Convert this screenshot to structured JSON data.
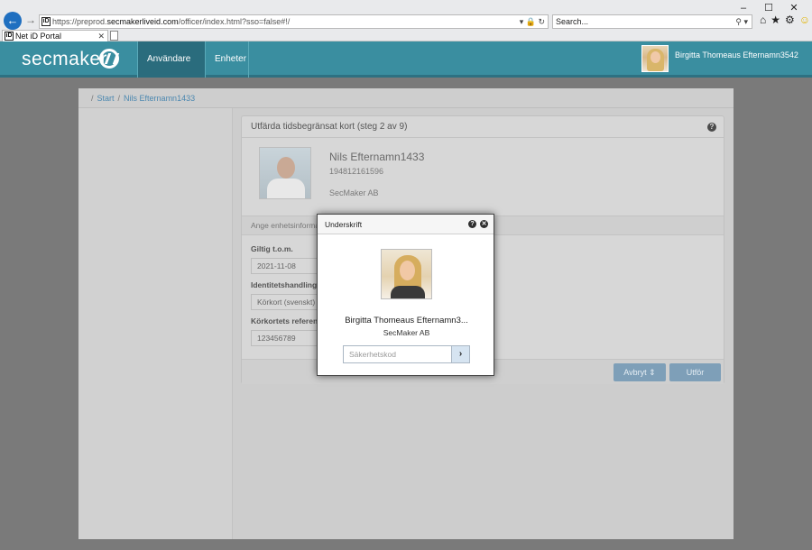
{
  "browser": {
    "url_prefix": "https://preprod.",
    "url_host": "secmakerliveid.com",
    "url_path": "/officer/index.html?sso=false#!/",
    "search_text": "Search...",
    "tab_title": "Net iD Portal",
    "favicon_text": "iD"
  },
  "header": {
    "logo": "secmaker",
    "nav_users": "Användare",
    "nav_users_badge": "1",
    "nav_devices": "Enheter",
    "user_name": "Birgitta Thomeaus Efternamn3542"
  },
  "breadcrumb": {
    "start": "Start",
    "current": "Nils Efternamn1433"
  },
  "panel": {
    "title": "Utfärda tidsbegränsat kort (steg 2 av 9)",
    "person": {
      "name": "Nils Efternamn1433",
      "id": "194812161596",
      "org": "SecMaker AB"
    },
    "section_title": "Ange enhetsinformation",
    "fields": {
      "valid_label": "Giltig t.o.m.",
      "valid_value": "2021-11-08",
      "id_doc_label": "Identitetshandling",
      "id_doc_value": "Körkort (svenskt)",
      "ref_label": "Körkortets referensnummer",
      "ref_value": "123456789"
    },
    "buttons": {
      "cancel": "Avbryt",
      "cancel_icon": "⇕",
      "submit": "Utför"
    }
  },
  "modal": {
    "title": "Underskrift",
    "signer_name": "Birgitta Thomeaus Efternamn3...",
    "signer_org": "SecMaker AB",
    "pin_placeholder": "Säkerhetskod"
  },
  "colors": {
    "brand": "#3a8ea0",
    "brand_dark": "#2a6c7d",
    "link": "#4c88b0",
    "button": "#7e9fb8"
  }
}
